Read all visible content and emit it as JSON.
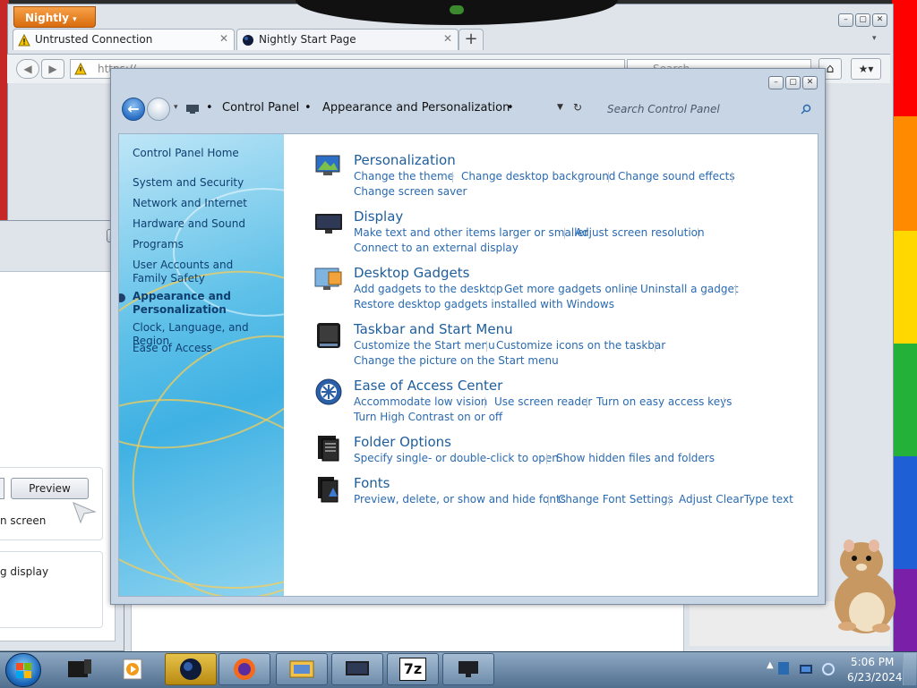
{
  "desktop": {
    "rainbow_colors": [
      "#ff0000",
      "#ff8a00",
      "#ffd800",
      "#23b13a",
      "#1f5fd6",
      "#7a1fa8"
    ]
  },
  "firefox": {
    "app_button_label": "Nightly",
    "tabs": [
      {
        "label": "Untrusted Connection",
        "icon": "warning-icon"
      },
      {
        "label": "Nightly Start Page",
        "icon": "nightly-globe-icon"
      }
    ],
    "new_tab_label": "+",
    "url": "https://...",
    "search_placeholder": "Search"
  },
  "left_window": {
    "preview_label": "Preview",
    "screen_text": "n screen",
    "display_text": "g display"
  },
  "control_panel": {
    "breadcrumbs": [
      "Control Panel",
      "Appearance and Personalization"
    ],
    "search_placeholder": "Search Control Panel",
    "nav": {
      "home": "Control Panel Home",
      "items": [
        "System and Security",
        "Network and Internet",
        "Hardware and Sound",
        "Programs",
        "User Accounts and Family Safety",
        "Appearance and Personalization",
        "Clock, Language, and Region",
        "Ease of Access"
      ],
      "current": "Appearance and Personalization"
    },
    "categories": [
      {
        "title": "Personalization",
        "icon": "personalization-icon",
        "links": [
          "Change the theme",
          "Change desktop background",
          "Change sound effects",
          "Change screen saver"
        ]
      },
      {
        "title": "Display",
        "icon": "display-icon",
        "links": [
          "Make text and other items larger or smaller",
          "Adjust screen resolution",
          "Connect to an external display"
        ]
      },
      {
        "title": "Desktop Gadgets",
        "icon": "gadgets-icon",
        "links": [
          "Add gadgets to the desktop",
          "Get more gadgets online",
          "Uninstall a gadget",
          "Restore desktop gadgets installed with Windows"
        ]
      },
      {
        "title": "Taskbar and Start Menu",
        "icon": "taskbar-icon",
        "links": [
          "Customize the Start menu",
          "Customize icons on the taskbar",
          "Change the picture on the Start menu"
        ]
      },
      {
        "title": "Ease of Access Center",
        "icon": "ease-of-access-icon",
        "links": [
          "Accommodate low vision",
          "Use screen reader",
          "Turn on easy access keys",
          "Turn High Contrast on or off"
        ]
      },
      {
        "title": "Folder Options",
        "icon": "folder-options-icon",
        "links": [
          "Specify single- or double-click to open",
          "Show hidden files and folders"
        ]
      },
      {
        "title": "Fonts",
        "icon": "fonts-icon",
        "links": [
          "Preview, delete, or show and hide fonts",
          "Change Font Settings",
          "Adjust ClearType text"
        ]
      }
    ]
  },
  "taskbar": {
    "apps": [
      {
        "name": "computer-icon"
      },
      {
        "name": "media-player-icon"
      },
      {
        "name": "nightly-icon",
        "active": true
      },
      {
        "name": "firefox-icon"
      },
      {
        "name": "control-panel-icon"
      },
      {
        "name": "display-icon"
      },
      {
        "name": "7zip-icon"
      },
      {
        "name": "monitor-icon"
      }
    ],
    "seven_zip_label": "7z",
    "time": "5:06 PM",
    "date": "6/23/2024"
  }
}
